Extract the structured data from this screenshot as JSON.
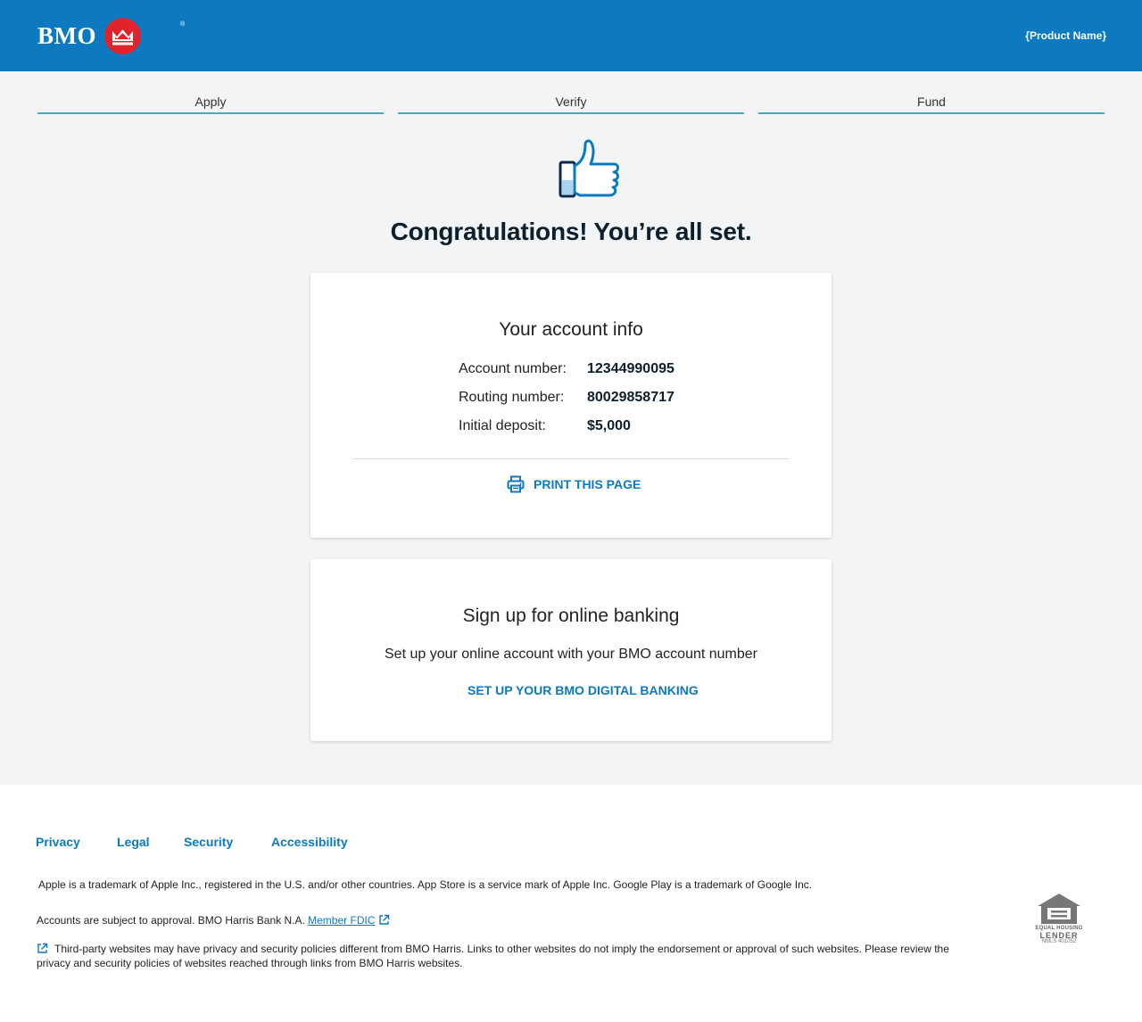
{
  "header": {
    "logo_text": "BMO",
    "logo_reg": "®",
    "product_name": "{Product Name}"
  },
  "steps": [
    {
      "label": "Apply"
    },
    {
      "label": "Verify"
    },
    {
      "label": "Fund"
    }
  ],
  "icons": {
    "thumb": "thumbs-up-icon",
    "print": "printer-icon",
    "external": "external-link-icon",
    "ehl": "equal-housing-lender-icon"
  },
  "colors": {
    "brand_blue": "#0d79c1",
    "brand_red": "#e1242b",
    "step_accent": "#36b0c9"
  },
  "congrats": "Congratulations! You’re all set.",
  "account_card": {
    "title": "Your account info",
    "rows": [
      {
        "label": "Account number:",
        "value": "12344990095"
      },
      {
        "label": "Routing number:",
        "value": "80029858717"
      },
      {
        "label": "Initial deposit:",
        "value": "$5,000"
      }
    ],
    "print_label": "PRINT THIS PAGE"
  },
  "banking_card": {
    "title": "Sign up for online banking",
    "description": "Set up your online account with your BMO account number",
    "cta": "SET UP YOUR BMO DIGITAL BANKING"
  },
  "footer": {
    "links": [
      {
        "label": "Privacy"
      },
      {
        "label": "Legal"
      },
      {
        "label": "Security"
      },
      {
        "label": "Accessibility"
      }
    ],
    "trademark": "Apple is a trademark of Apple Inc., registered in the U.S. and/or other countries. App Store is a service mark of Apple Inc. Google Play is a trademark of Google Inc.",
    "approval_prefix": "Accounts are subject to approval. BMO Harris Bank N.A.",
    "fdic_link": "Member FDIC",
    "third_party": "Third-party websites may have privacy and security policies different from BMO Harris. Links to other websites do not imply the endorsement or approval of such websites. Please review the privacy and security policies of websites reached through links from BMO Harris websites.",
    "ehl_line1": "EQUAL HOUSING",
    "ehl_line2": "LENDER",
    "ehl_nmls": "NMLS 401052"
  }
}
